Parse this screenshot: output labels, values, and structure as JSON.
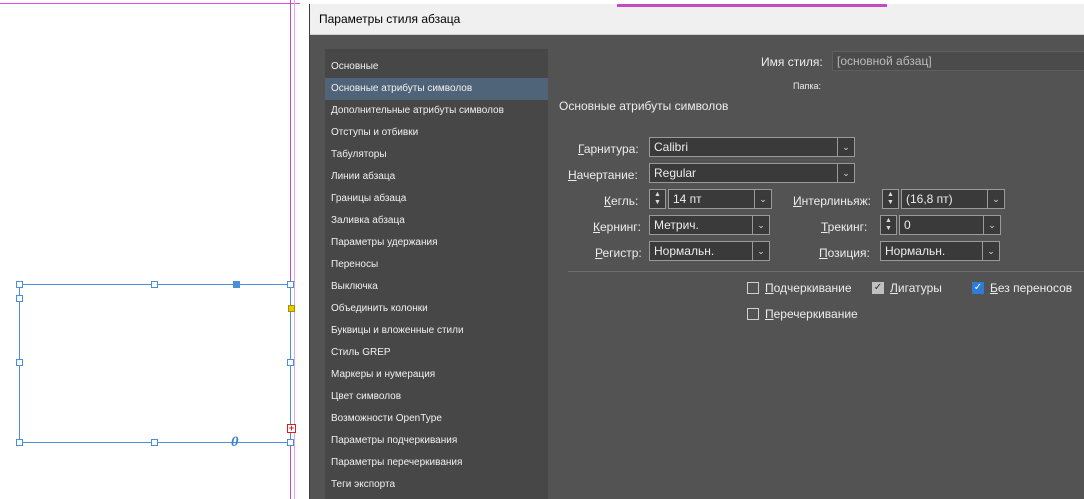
{
  "dialog": {
    "title": "Параметры стиля абзаца",
    "style_name_label": "Имя стиля:",
    "style_name_value": "[основной абзац]",
    "folder_label": "Папка:",
    "section_title": "Основные атрибуты символов"
  },
  "sidebar": {
    "items": [
      {
        "label": "Основные"
      },
      {
        "label": "Основные атрибуты символов"
      },
      {
        "label": "Дополнительные атрибуты символов"
      },
      {
        "label": "Отступы и отбивки"
      },
      {
        "label": "Табуляторы"
      },
      {
        "label": "Линии абзаца"
      },
      {
        "label": "Границы абзаца"
      },
      {
        "label": "Заливка абзаца"
      },
      {
        "label": "Параметры удержания"
      },
      {
        "label": "Переносы"
      },
      {
        "label": "Выключка"
      },
      {
        "label": "Объединить колонки"
      },
      {
        "label": "Буквицы и вложенные стили"
      },
      {
        "label": "Стиль GREP"
      },
      {
        "label": "Маркеры и нумерация"
      },
      {
        "label": "Цвет символов"
      },
      {
        "label": "Возможности OpenType"
      },
      {
        "label": "Параметры подчеркивания"
      },
      {
        "label": "Параметры перечеркивания"
      },
      {
        "label": "Теги экспорта"
      }
    ],
    "active_index": 1
  },
  "fields": {
    "font_family": {
      "label_u": "Г",
      "label_rest": "арнитура:",
      "value": "Calibri"
    },
    "font_style": {
      "label_u": "Н",
      "label_rest": "ачертание:",
      "value": "Regular"
    },
    "size": {
      "label_u": "К",
      "label_rest": "егль:",
      "value": "14 пт"
    },
    "leading": {
      "label_u": "И",
      "label_rest": "нтерлиньяж:",
      "value": "(16,8 пт)"
    },
    "kerning": {
      "label_u": "К",
      "label_rest": "ернинг:",
      "value": "Метрич."
    },
    "tracking": {
      "label_u": "Т",
      "label_rest": "рекинг:",
      "value": "0"
    },
    "case": {
      "label_u": "Р",
      "label_rest": "егистр:",
      "value": "Нормальн."
    },
    "position": {
      "label_u": "П",
      "label_rest": "озиция:",
      "value": "Нормальн."
    }
  },
  "checkboxes": {
    "underline": {
      "label_u": "П",
      "label_rest": "одчеркивание",
      "checked": false
    },
    "ligatures": {
      "label_u": "Л",
      "label_rest": "игатуры",
      "checked": true
    },
    "no_break": {
      "label_u": "Б",
      "label_rest": "ез переносов",
      "checked": true
    },
    "strikethrough": {
      "label_u": "П",
      "label_rest": "еречеркивание",
      "checked": false
    }
  },
  "icons": {
    "dropdown": "chevron-down-icon",
    "stepper": "up-down-arrows-icon",
    "check": "checkmark-icon"
  },
  "colors": {
    "dialog_bg": "#535353",
    "sidebar_bg": "#474747",
    "sidebar_active": "#4f6479",
    "selection": "#4a90d9",
    "checkbox_blue": "#2f7cd6"
  }
}
